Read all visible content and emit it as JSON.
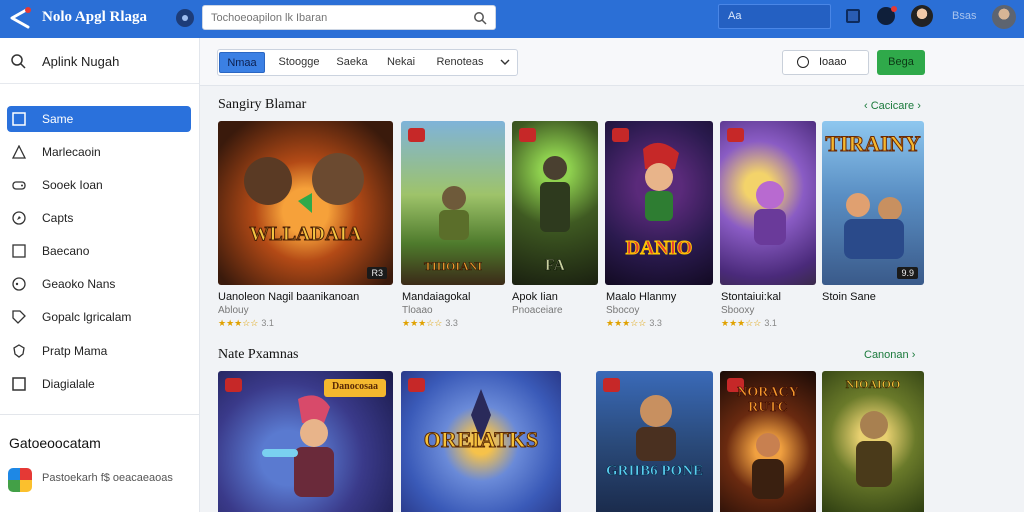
{
  "header": {
    "brand": "Nolo Apgl Rlaga",
    "search_placeholder": "Tochoeoapilon lk Ibaran",
    "field_text": "Aa",
    "user_label": "Bsas"
  },
  "sidebar": {
    "search_label": "Aplink Nugah",
    "items": [
      {
        "label": "Same",
        "icon": "square-icon",
        "active": true
      },
      {
        "label": "Marlecaoin",
        "icon": "triangle-icon"
      },
      {
        "label": "Sooek Ioan",
        "icon": "controller-icon"
      },
      {
        "label": "Capts",
        "icon": "compass-icon"
      },
      {
        "label": "Baecano",
        "icon": "box-icon"
      },
      {
        "label": "Geaoko Nans",
        "icon": "globe-icon"
      },
      {
        "label": "Gopalc lgricalam",
        "icon": "tag-icon"
      },
      {
        "label": "Pratp Mama",
        "icon": "shield-icon"
      },
      {
        "label": "Diagialale",
        "icon": "checkbox-icon"
      }
    ],
    "heading": "Gatoeoocatam",
    "app_label": "Pastoekarh f$ oeacaeaoas"
  },
  "tabs": {
    "items": [
      "Nmaa",
      "Stoogge",
      "Saeka",
      "Nekai",
      "Renoteas"
    ],
    "active_index": 0
  },
  "toolbar": {
    "filter_label": "Ioaao",
    "action_label": "Bega"
  },
  "sections": [
    {
      "title": "Sangiry Blamar",
      "link": "Cacicare",
      "games": [
        {
          "title": "Uanoleon Nagil baanikanoan",
          "sub": "Ablouy",
          "stars": "★★★☆☆",
          "score": "3.1",
          "logo": "WLLADAIA",
          "rating_pill": "R3"
        },
        {
          "title": "Mandaiagokal",
          "sub": "Tloaao",
          "stars": "★★★☆☆",
          "score": "3.3",
          "logo": "TIIIOIANI",
          "rating_pill": ""
        },
        {
          "title": "Apok Iian",
          "sub": "Pnoaceiare",
          "stars": "",
          "score": "",
          "logo": "FA",
          "rating_pill": ""
        },
        {
          "title": "Maalo Hlanmy",
          "sub": "Sbocoy",
          "stars": "★★★☆☆",
          "score": "3.3",
          "logo": "DANIO",
          "rating_pill": ""
        },
        {
          "title": "Stontaiui:kal",
          "sub": "Sbooxy",
          "stars": "★★★☆☆",
          "score": "3.1",
          "logo": "",
          "rating_pill": ""
        },
        {
          "title": "Stoin Sane",
          "sub": "",
          "stars": "",
          "score": "",
          "logo": "TIRAINY",
          "rating_pill": "9.9"
        }
      ]
    },
    {
      "title": "Nate Pxamnas",
      "link": "Canonan",
      "games": [
        {
          "title": "",
          "sub": "",
          "stars": "",
          "score": "",
          "logo": "Danocosaa",
          "rating_pill": ""
        },
        {
          "title": "",
          "sub": "",
          "stars": "",
          "score": "",
          "logo": "OREIATKS",
          "rating_pill": ""
        },
        {
          "title": "",
          "sub": "",
          "stars": "",
          "score": "",
          "logo": "GRIIB6 PONE",
          "rating_pill": ""
        },
        {
          "title": "",
          "sub": "",
          "stars": "",
          "score": "",
          "logo": "NORACY RUTC",
          "rating_pill": ""
        },
        {
          "title": "",
          "sub": "",
          "stars": "",
          "score": "",
          "logo": "NIOAIOO",
          "rating_pill": ""
        }
      ]
    }
  ]
}
